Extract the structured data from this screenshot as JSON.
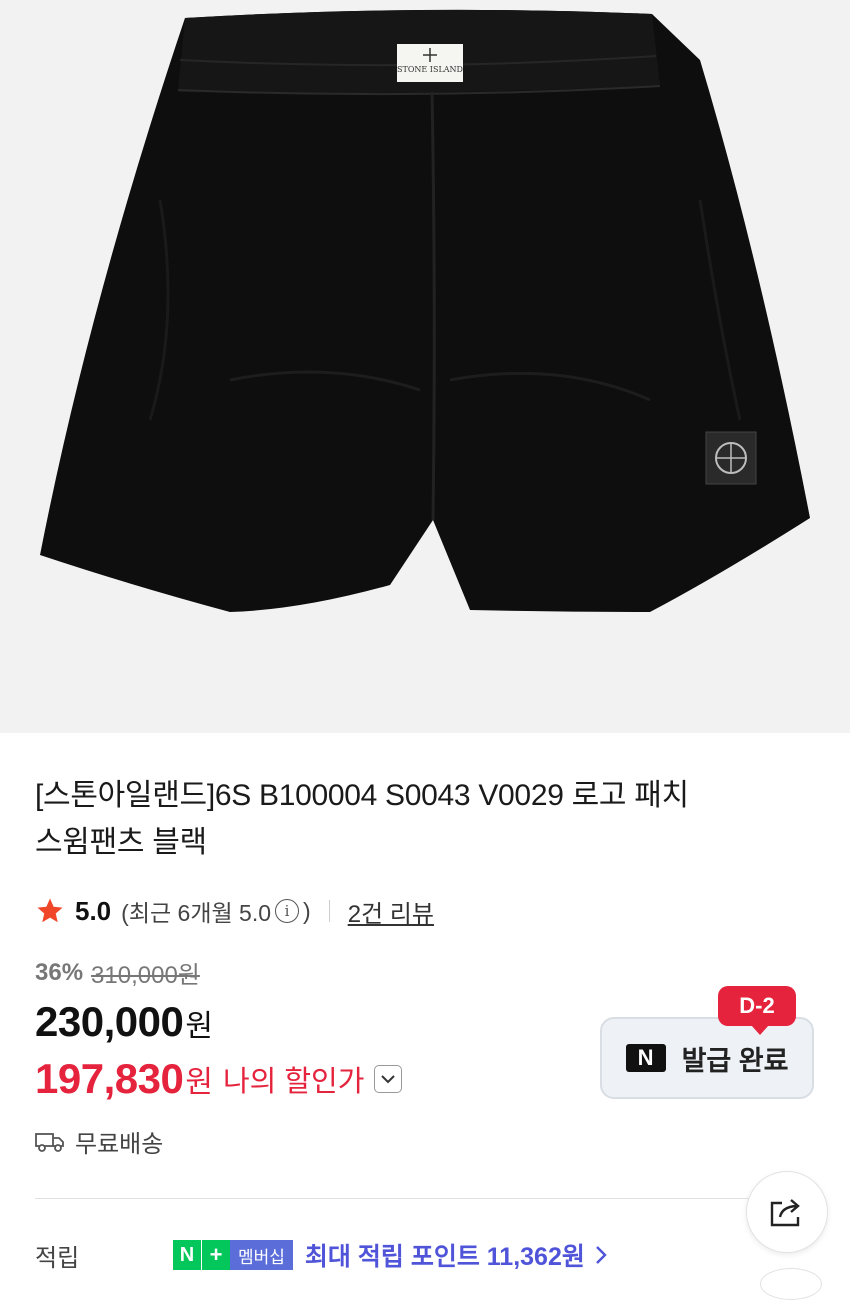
{
  "product": {
    "title_line1": "[스톤아일랜드]6S B100004 S0043 V0029 로고 패치",
    "title_line2": "스윔팬츠 블랙",
    "image_label": "STONE ISLAND"
  },
  "rating": {
    "score": "5.0",
    "recent_text": "(최근 6개월 5.0",
    "recent_close": ")",
    "info_icon": "i",
    "review_link": "2건 리뷰"
  },
  "pricing": {
    "discount_pct": "36%",
    "original_price": "310,000원",
    "sale_price": "230,000",
    "sale_unit": "원",
    "my_price": "197,830",
    "my_unit": "원",
    "my_label": "나의 할인가"
  },
  "coupon": {
    "badge": "N",
    "label": "발급 완료",
    "dday": "D-2"
  },
  "shipping": {
    "text": "무료배송"
  },
  "points": {
    "label": "적립",
    "n_badge": "N",
    "plus_badge": "+",
    "membership_badge": "멤버십",
    "text": "최대 적립 포인트 11,362원"
  },
  "colors": {
    "accent_red": "#e5233d",
    "points_blue": "#4f54d8",
    "naver_green": "#03c75a",
    "star": "#f0462a"
  },
  "icons": [
    "star-icon",
    "info-icon",
    "chevron-down-icon",
    "truck-icon",
    "share-icon",
    "chevron-right-icon"
  ]
}
